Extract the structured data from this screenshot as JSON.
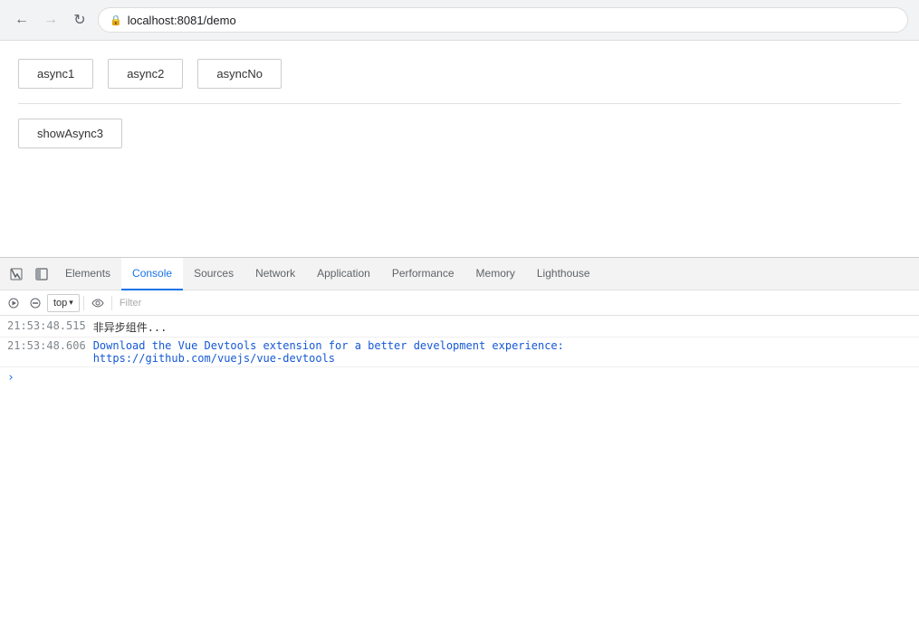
{
  "browser": {
    "back_btn": "←",
    "forward_btn": "→",
    "reload_btn": "↻",
    "lock_icon": "🔒",
    "url": "localhost:8081/demo"
  },
  "page": {
    "buttons": [
      {
        "label": "async1"
      },
      {
        "label": "async2"
      },
      {
        "label": "asyncNo"
      }
    ],
    "second_buttons": [
      {
        "label": "showAsync3"
      }
    ]
  },
  "devtools": {
    "tabs": [
      {
        "label": "Elements",
        "active": false
      },
      {
        "label": "Console",
        "active": true
      },
      {
        "label": "Sources",
        "active": false
      },
      {
        "label": "Network",
        "active": false
      },
      {
        "label": "Application",
        "active": false
      },
      {
        "label": "Performance",
        "active": false
      },
      {
        "label": "Memory",
        "active": false
      },
      {
        "label": "Lighthouse",
        "active": false
      }
    ],
    "console": {
      "top_label": "top",
      "filter_placeholder": "Filter",
      "lines": [
        {
          "timestamp": "21:53:48.515",
          "message": "非异步组件...",
          "type": "normal",
          "link": null
        },
        {
          "timestamp": "21:53:48.606",
          "message": "Download the Vue Devtools extension for a better development experience:",
          "type": "info",
          "link": "https://github.com/vuejs/vue-devtools",
          "link_text": "https://github.com/vuejs/vue-devtools"
        }
      ]
    }
  },
  "icons": {
    "selector_icon": "▸",
    "cursor_icon": "⊡",
    "dock_icon": "⊡",
    "block_icon": "⊘",
    "eye_icon": "👁",
    "caret_down": "▾"
  }
}
